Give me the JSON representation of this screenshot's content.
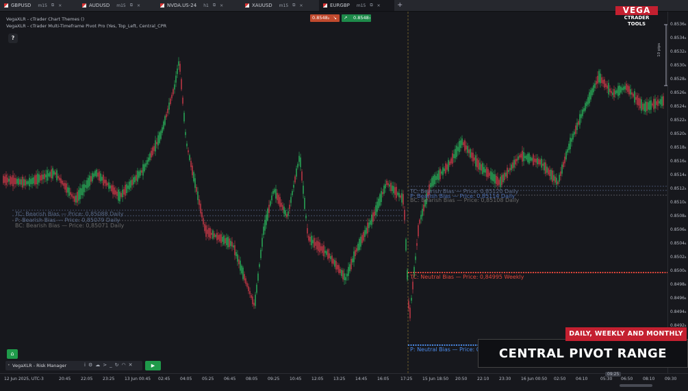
{
  "tabs": [
    {
      "symbol": "GBPUSD",
      "timeframe": "m15"
    },
    {
      "symbol": "AUDUSD",
      "timeframe": "m15"
    },
    {
      "symbol": "NVDA.US-24",
      "timeframe": "h1"
    },
    {
      "symbol": "XAUUSD",
      "timeframe": "m15"
    },
    {
      "symbol": "EURGBP",
      "timeframe": "m15"
    }
  ],
  "add_tab": "+",
  "chart_info": {
    "line1": "VegaXLR - cTrader Chart Themes ()",
    "line2": "VegaXLR - cTrader Multi-Timeframe Pivot Pro (Yes, Top_Left, Central_CPR",
    "help": "?"
  },
  "quote": {
    "sell": "0.8548₂",
    "buy": "0.8548₇",
    "sell_color": "#c04a2e",
    "buy_color": "#1e8a4a"
  },
  "logo": {
    "brand": "VEGA",
    "sub": "CTRADER TOOLS"
  },
  "pips_label": "10 pips",
  "y_axis": [
    "0.8536₈",
    "0.8534₈",
    "0.8532₈",
    "0.8530₈",
    "0.8528₈",
    "0.8526₈",
    "0.8524₈",
    "0.8522₈",
    "0.8520₈",
    "0.8518₈",
    "0.8516₈",
    "0.8514₈",
    "0.8512₈",
    "0.8510₈",
    "0.8508₈",
    "0.8506₈",
    "0.8504₈",
    "0.8502₈",
    "0.8500₈",
    "0.8498₈",
    "0.8496₈",
    "0.8494₈",
    "0.8492₈"
  ],
  "x_axis": [
    "12 Jun 2025, UTC-3",
    "20:45",
    "22:05",
    "23:25",
    "13 Jun 00:45",
    "02:45",
    "04:05",
    "05:25",
    "06:45",
    "08:05",
    "09:25",
    "10:45",
    "12:05",
    "13:25",
    "14:45",
    "16:05",
    "17:25",
    "15 Jun 18:50",
    "20:50",
    "22:10",
    "23:30",
    "16 Jun 00:50",
    "02:50",
    "04:10",
    "05:30",
    "06:50",
    "08:10",
    "09:30"
  ],
  "x_highlight": "09:25",
  "pivot_labels": [
    {
      "text": "TC: Bearish Bias —  Price: 0,85088 Daily",
      "color": "#5a6b8a"
    },
    {
      "text": "P: Bearish Bias —  Price: 0,85079 Daily",
      "color": "#5a6b8a"
    },
    {
      "text": "BC: Bearish Bias —  Price: 0,85071 Daily",
      "color": "#6a6a6a"
    },
    {
      "text": "TC: Bearish Bias —  Price: 0,85120 Daily",
      "color": "#5a6b8a"
    },
    {
      "text": "P: Bearish Bias —  Price: 0,85114 Daily",
      "color": "#4b6fb4"
    },
    {
      "text": "BC: Bearish Bias —  Price: 0,85108 Daily",
      "color": "#6a6a6a"
    },
    {
      "text": "TC: Neutral Bias —  Price: 0,84995 Weekly",
      "color": "#e2463a"
    },
    {
      "text": "P: Neutral Bias —  Price: 0",
      "color": "#4b8ae8"
    }
  ],
  "risk_manager": {
    "title": "VegaXLR - Risk Manager",
    "icons": [
      "info-icon",
      "gear-icon",
      "cloud-icon",
      "terminal-icon",
      "history-icon",
      "gauge-icon",
      "close-icon"
    ]
  },
  "play_label": "▶",
  "banner": {
    "top": "DAILY, WEEKLY AND MONTHLY",
    "main": "CENTRAL PIVOT RANGE"
  },
  "colors": {
    "bull": "#2bb75c",
    "bear": "#d23a4a",
    "background": "#17181d"
  }
}
